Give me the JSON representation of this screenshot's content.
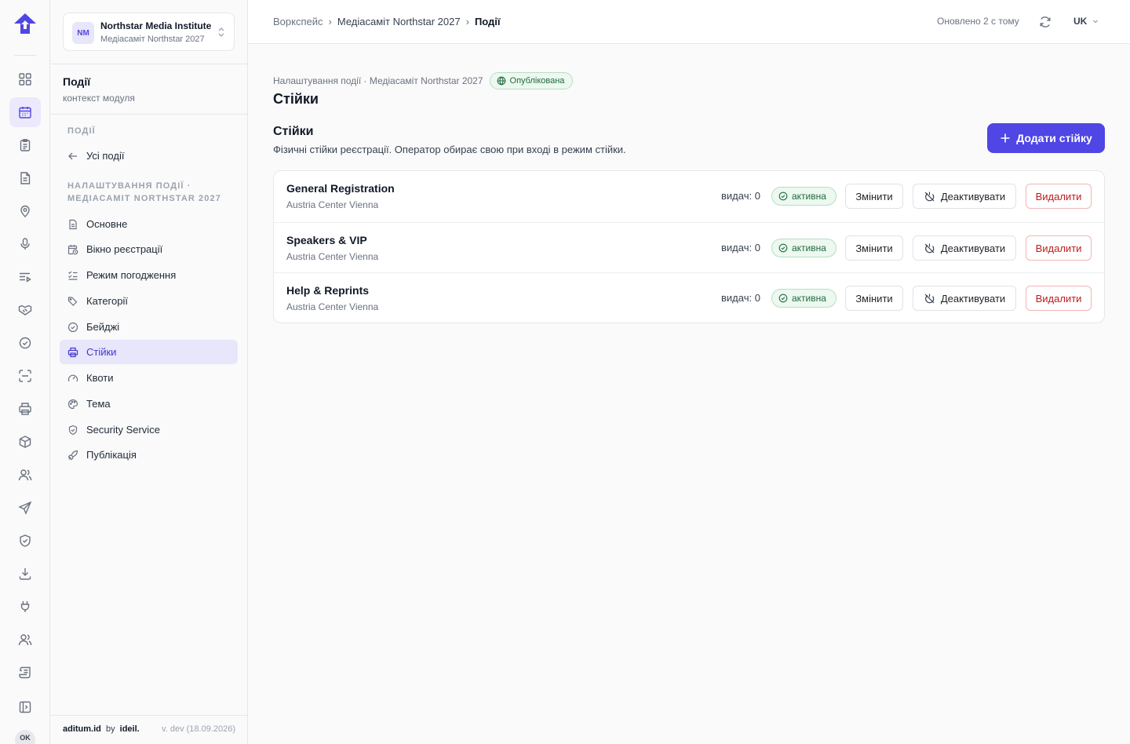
{
  "rail": {
    "items": [
      {
        "name": "rail-dashboard",
        "icon": "grid-icon"
      },
      {
        "name": "rail-events",
        "icon": "calendar-icon",
        "active": true
      },
      {
        "name": "rail-tasks",
        "icon": "clipboard-icon"
      },
      {
        "name": "rail-documents",
        "icon": "file-icon"
      },
      {
        "name": "rail-locations",
        "icon": "map-pin-icon"
      },
      {
        "name": "rail-audio",
        "icon": "microphone-icon"
      },
      {
        "name": "rail-agenda",
        "icon": "list-play-icon"
      },
      {
        "name": "rail-partners",
        "icon": "handshake-icon"
      },
      {
        "name": "rail-approvals",
        "icon": "check-badge-icon"
      },
      {
        "name": "rail-scan",
        "icon": "scan-icon"
      },
      {
        "name": "rail-print",
        "icon": "printer-icon"
      },
      {
        "name": "rail-packages",
        "icon": "box-icon"
      },
      {
        "name": "rail-people",
        "icon": "users-icon"
      },
      {
        "name": "rail-send",
        "icon": "send-icon"
      },
      {
        "name": "rail-security",
        "icon": "shield-check-icon"
      },
      {
        "name": "rail-downloads",
        "icon": "download-icon"
      },
      {
        "name": "rail-integrations",
        "icon": "plug-icon"
      },
      {
        "name": "rail-team",
        "icon": "users-icon"
      },
      {
        "name": "rail-logs",
        "icon": "scroll-icon"
      },
      {
        "name": "rail-collapse",
        "icon": "panel-icon"
      }
    ],
    "avatar": "OK"
  },
  "sidebar": {
    "org_initials": "NM",
    "org_name": "Northstar Media Institute",
    "org_sub": "Медіасаміт Northstar 2027",
    "module_title": "Події",
    "module_sub": "контекст модуля",
    "section_events": "ПОДІЇ",
    "all_events": "Усі події",
    "section_settings_1": "НАЛАШТУВАННЯ ПОДІЇ ·",
    "section_settings_2": "МЕДІАСАМІТ NORTHSTAR 2027",
    "items": [
      {
        "label": "Основне",
        "icon": "file-icon"
      },
      {
        "label": "Вікно реєстрації",
        "icon": "calendar-clock-icon"
      },
      {
        "label": "Режим погодження",
        "icon": "list-check-icon"
      },
      {
        "label": "Категорії",
        "icon": "tags-icon"
      },
      {
        "label": "Бейджі",
        "icon": "check-circle-icon"
      },
      {
        "label": "Стійки",
        "icon": "printer-icon",
        "active": true
      },
      {
        "label": "Квоти",
        "icon": "gauge-icon"
      },
      {
        "label": "Тема",
        "icon": "palette-icon"
      },
      {
        "label": "Security Service",
        "icon": "shield-icon"
      },
      {
        "label": "Публікація",
        "icon": "rocket-icon"
      }
    ],
    "footer_brand": "aditum.id",
    "footer_by": "by",
    "footer_company": "ideil.",
    "footer_version": "v. dev (18.09.2026)"
  },
  "topbar": {
    "crumb_1": "Воркспейс",
    "crumb_2": "Медіасаміт Northstar 2027",
    "crumb_3": "Події",
    "updated": "Оновлено 2 с тому",
    "lang": "UK"
  },
  "page": {
    "kicker": "Налаштування події · Медіасаміт Northstar 2027",
    "published_badge": "Опублікована",
    "title": "Стійки",
    "section_title": "Стійки",
    "section_desc": "Фізичні стійки реєстрації. Оператор обирає свою при вході в режим стійки.",
    "add_button": "Додати стійку"
  },
  "desks": [
    {
      "name": "General Registration",
      "location": "Austria Center Vienna",
      "issued": "видач: 0",
      "status": "активна",
      "edit": "Змінити",
      "deactivate": "Деактивувати",
      "delete": "Видалити"
    },
    {
      "name": "Speakers & VIP",
      "location": "Austria Center Vienna",
      "issued": "видач: 0",
      "status": "активна",
      "edit": "Змінити",
      "deactivate": "Деактивувати",
      "delete": "Видалити"
    },
    {
      "name": "Help & Reprints",
      "location": "Austria Center Vienna",
      "issued": "видач: 0",
      "status": "активна",
      "edit": "Змінити",
      "deactivate": "Деактивувати",
      "delete": "Видалити"
    }
  ],
  "colors": {
    "accent": "#4f46e5",
    "accent_soft": "#e8e6fb",
    "success": "#1f6b3a",
    "danger": "#c11b1b"
  }
}
